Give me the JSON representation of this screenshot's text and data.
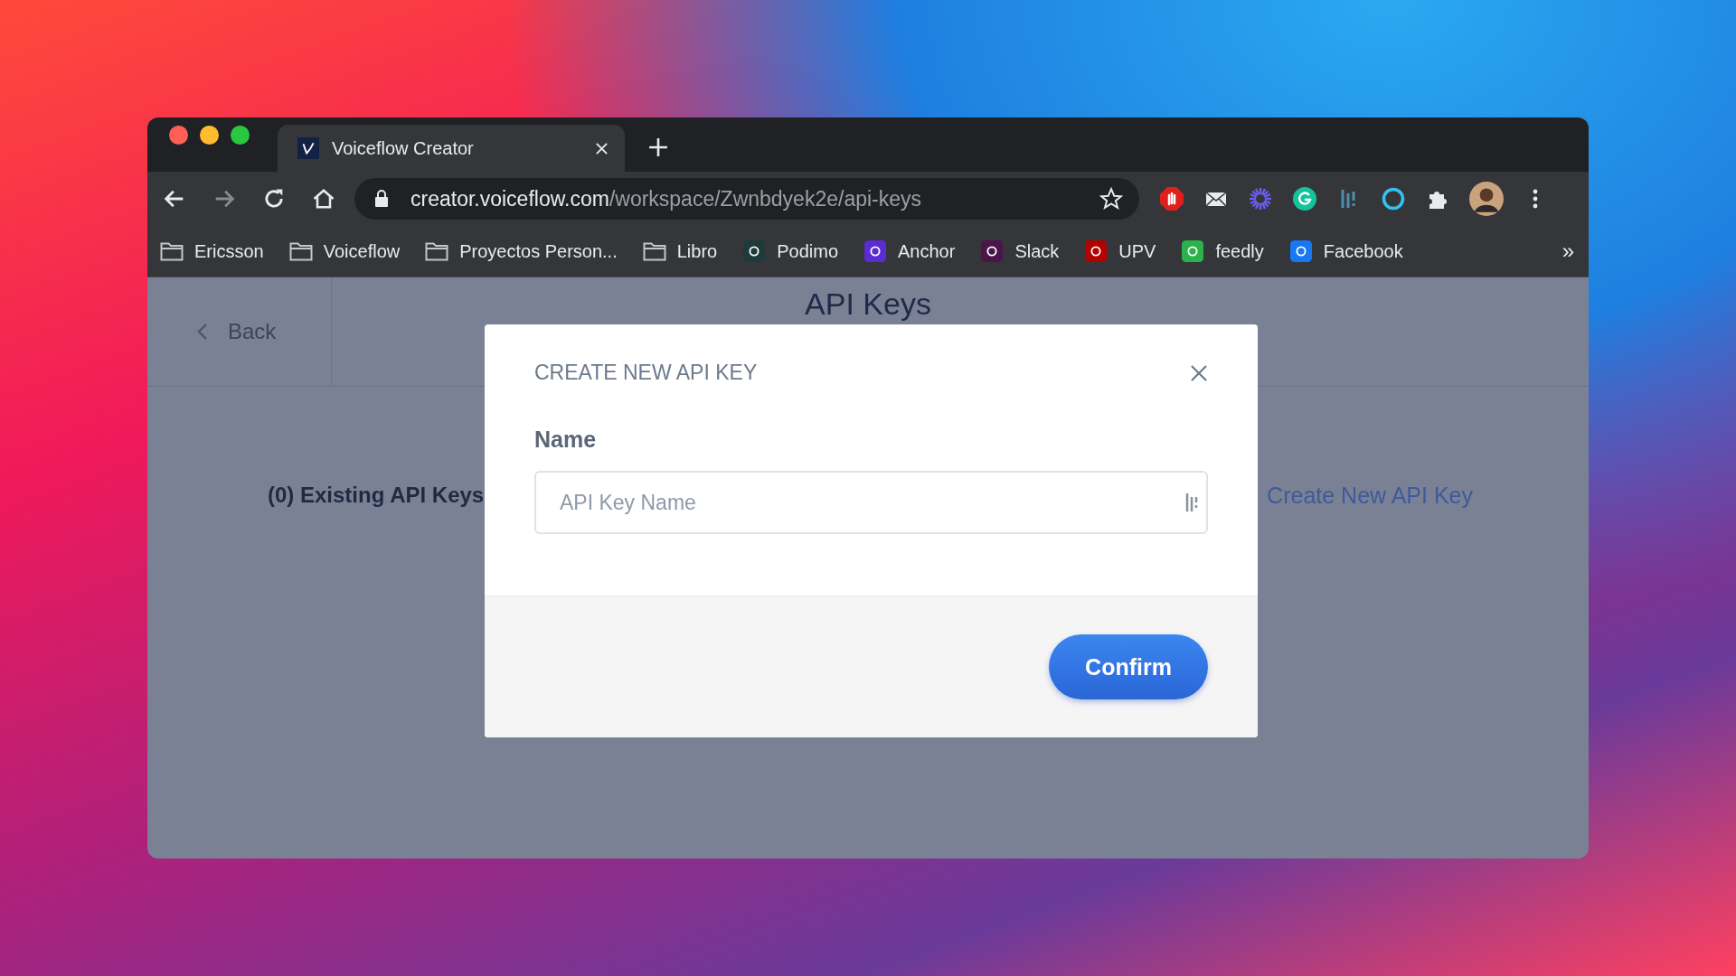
{
  "browser": {
    "tab": {
      "title": "Voiceflow Creator"
    },
    "url": {
      "host": "creator.voiceflow.com",
      "path": "/workspace/Zwnbdyek2e/api-keys"
    },
    "bookmarks": [
      {
        "label": "Ericsson",
        "kind": "folder"
      },
      {
        "label": "Voiceflow",
        "kind": "folder"
      },
      {
        "label": "Proyectos Person...",
        "kind": "folder"
      },
      {
        "label": "Libro",
        "kind": "folder"
      },
      {
        "label": "Podimo",
        "kind": "site",
        "color": "#1f3a3a"
      },
      {
        "label": "Anchor",
        "kind": "site",
        "color": "#5b2bd4"
      },
      {
        "label": "Slack",
        "kind": "site",
        "color": "#4a154b"
      },
      {
        "label": "UPV",
        "kind": "site",
        "color": "#b30000"
      },
      {
        "label": "feedly",
        "kind": "site",
        "color": "#2bb24c"
      },
      {
        "label": "Facebook",
        "kind": "site",
        "color": "#1877f2"
      }
    ],
    "overflow": "»"
  },
  "page": {
    "back": "Back",
    "title": "API Keys",
    "count_text": "(0) Existing API Keys",
    "create_link": "Create New API Key"
  },
  "modal": {
    "title": "CREATE NEW API KEY",
    "field_label": "Name",
    "placeholder": "API Key Name",
    "confirm": "Confirm"
  }
}
